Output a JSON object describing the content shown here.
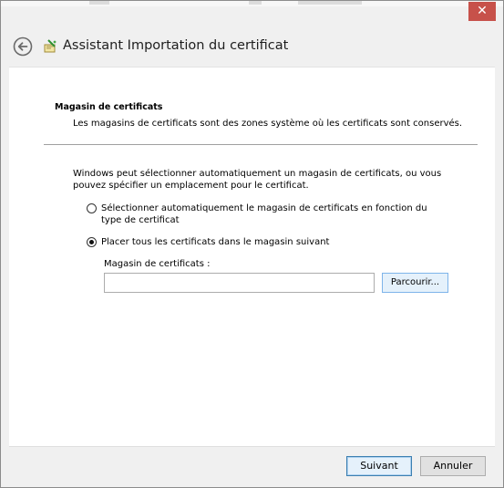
{
  "window": {
    "title": "Assistant Importation du certificat",
    "close_glyph": "✕",
    "back_icon": "back-arrow-icon",
    "wizard_icon": "certificate-wizard-icon"
  },
  "page": {
    "heading": "Magasin de certificats",
    "description": "Les magasins de certificats sont des zones système où les certificats sont conservés.",
    "intro": "Windows peut sélectionner automatiquement un magasin de certificats, ou vous pouvez spécifier un emplacement pour le certificat.",
    "options": [
      {
        "label": "Sélectionner automatiquement le magasin de certificats en fonction du type de certificat",
        "selected": false
      },
      {
        "label": "Placer tous les certificats dans le magasin suivant",
        "selected": true
      }
    ],
    "store_label": "Magasin de certificats :",
    "store_value": "",
    "browse_label": "Parcourir..."
  },
  "footer": {
    "next_label": "Suivant",
    "cancel_label": "Annuler"
  },
  "colors": {
    "close": "#c7514a",
    "focus_border": "#3c7fb1",
    "accent_fill": "#e5f1fb"
  }
}
